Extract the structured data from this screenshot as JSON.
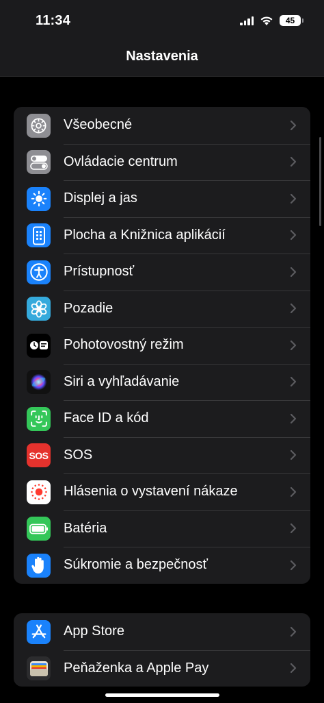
{
  "status_bar": {
    "time": "11:34",
    "battery": "45"
  },
  "nav": {
    "title": "Nastavenia"
  },
  "group1": [
    {
      "label": "Všeobecné",
      "icon": "gear-icon",
      "color": "#8e8e93"
    },
    {
      "label": "Ovládacie centrum",
      "icon": "toggles-icon",
      "color": "#8e8e93"
    },
    {
      "label": "Displej a jas",
      "icon": "sun-icon",
      "color": "#1a82fb"
    },
    {
      "label": "Plocha a Knižnica aplikácií",
      "icon": "home-screen-icon",
      "color": "#1a82fb"
    },
    {
      "label": "Prístupnosť",
      "icon": "accessibility-icon",
      "color": "#1a82fb"
    },
    {
      "label": "Pozadie",
      "icon": "flower-icon",
      "color": "#35aadc"
    },
    {
      "label": "Pohotovostný režim",
      "icon": "standby-icon",
      "color": "#000000"
    },
    {
      "label": "Siri a vyhľadávanie",
      "icon": "siri-icon",
      "color": "#1c1c2e"
    },
    {
      "label": "Face ID a kód",
      "icon": "face-id-icon",
      "color": "#34c759"
    },
    {
      "label": "SOS",
      "icon": "sos-icon",
      "color": "#e5322d",
      "icon_text": "SOS"
    },
    {
      "label": "Hlásenia o vystavení nákaze",
      "icon": "exposure-icon",
      "color": "#ffffff"
    },
    {
      "label": "Batéria",
      "icon": "battery-icon",
      "color": "#34c759"
    },
    {
      "label": "Súkromie a bezpečnosť",
      "icon": "hand-icon",
      "color": "#1a82fb"
    }
  ],
  "group2": [
    {
      "label": "App Store",
      "icon": "app-store-icon",
      "color": "#1a82fb"
    },
    {
      "label": "Peňaženka a Apple Pay",
      "icon": "wallet-icon",
      "color": "#2c2c2e"
    }
  ]
}
